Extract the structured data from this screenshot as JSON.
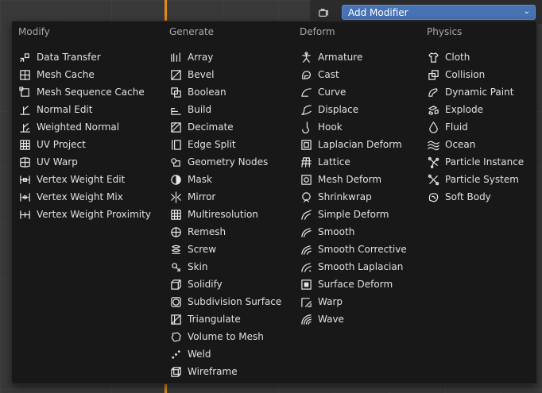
{
  "header": {
    "add_modifier_label": "Add Modifier"
  },
  "menu": {
    "columns": [
      {
        "title": "Modify",
        "items": [
          {
            "label": "Data Transfer",
            "icon": "data-transfer-icon"
          },
          {
            "label": "Mesh Cache",
            "icon": "mesh-cache-icon"
          },
          {
            "label": "Mesh Sequence Cache",
            "icon": "mesh-sequence-cache-icon"
          },
          {
            "label": "Normal Edit",
            "icon": "normal-edit-icon"
          },
          {
            "label": "Weighted Normal",
            "icon": "weighted-normal-icon"
          },
          {
            "label": "UV Project",
            "icon": "uv-project-icon"
          },
          {
            "label": "UV Warp",
            "icon": "uv-warp-icon"
          },
          {
            "label": "Vertex Weight Edit",
            "icon": "vertex-weight-edit-icon"
          },
          {
            "label": "Vertex Weight Mix",
            "icon": "vertex-weight-mix-icon"
          },
          {
            "label": "Vertex Weight Proximity",
            "icon": "vertex-weight-proximity-icon"
          }
        ]
      },
      {
        "title": "Generate",
        "items": [
          {
            "label": "Array",
            "icon": "array-icon"
          },
          {
            "label": "Bevel",
            "icon": "bevel-icon"
          },
          {
            "label": "Boolean",
            "icon": "boolean-icon"
          },
          {
            "label": "Build",
            "icon": "build-icon"
          },
          {
            "label": "Decimate",
            "icon": "decimate-icon"
          },
          {
            "label": "Edge Split",
            "icon": "edge-split-icon"
          },
          {
            "label": "Geometry Nodes",
            "icon": "geometry-nodes-icon"
          },
          {
            "label": "Mask",
            "icon": "mask-icon"
          },
          {
            "label": "Mirror",
            "icon": "mirror-icon"
          },
          {
            "label": "Multiresolution",
            "icon": "multiresolution-icon"
          },
          {
            "label": "Remesh",
            "icon": "remesh-icon"
          },
          {
            "label": "Screw",
            "icon": "screw-icon"
          },
          {
            "label": "Skin",
            "icon": "skin-icon"
          },
          {
            "label": "Solidify",
            "icon": "solidify-icon"
          },
          {
            "label": "Subdivision Surface",
            "icon": "subdivision-surface-icon"
          },
          {
            "label": "Triangulate",
            "icon": "triangulate-icon"
          },
          {
            "label": "Volume to Mesh",
            "icon": "volume-to-mesh-icon"
          },
          {
            "label": "Weld",
            "icon": "weld-icon"
          },
          {
            "label": "Wireframe",
            "icon": "wireframe-icon"
          }
        ]
      },
      {
        "title": "Deform",
        "items": [
          {
            "label": "Armature",
            "icon": "armature-icon"
          },
          {
            "label": "Cast",
            "icon": "cast-icon"
          },
          {
            "label": "Curve",
            "icon": "curve-icon"
          },
          {
            "label": "Displace",
            "icon": "displace-icon"
          },
          {
            "label": "Hook",
            "icon": "hook-icon"
          },
          {
            "label": "Laplacian Deform",
            "icon": "laplacian-deform-icon"
          },
          {
            "label": "Lattice",
            "icon": "lattice-icon"
          },
          {
            "label": "Mesh Deform",
            "icon": "mesh-deform-icon"
          },
          {
            "label": "Shrinkwrap",
            "icon": "shrinkwrap-icon"
          },
          {
            "label": "Simple Deform",
            "icon": "simple-deform-icon"
          },
          {
            "label": "Smooth",
            "icon": "smooth-icon"
          },
          {
            "label": "Smooth Corrective",
            "icon": "smooth-corrective-icon"
          },
          {
            "label": "Smooth Laplacian",
            "icon": "smooth-laplacian-icon"
          },
          {
            "label": "Surface Deform",
            "icon": "surface-deform-icon"
          },
          {
            "label": "Warp",
            "icon": "warp-icon"
          },
          {
            "label": "Wave",
            "icon": "wave-icon"
          }
        ]
      },
      {
        "title": "Physics",
        "items": [
          {
            "label": "Cloth",
            "icon": "cloth-icon"
          },
          {
            "label": "Collision",
            "icon": "collision-icon"
          },
          {
            "label": "Dynamic Paint",
            "icon": "dynamic-paint-icon"
          },
          {
            "label": "Explode",
            "icon": "explode-icon"
          },
          {
            "label": "Fluid",
            "icon": "fluid-icon"
          },
          {
            "label": "Ocean",
            "icon": "ocean-icon"
          },
          {
            "label": "Particle Instance",
            "icon": "particle-instance-icon"
          },
          {
            "label": "Particle System",
            "icon": "particle-system-icon"
          },
          {
            "label": "Soft Body",
            "icon": "soft-body-icon"
          }
        ]
      }
    ]
  },
  "colors": {
    "accent": "#4772b3",
    "menu_bg": "#181818",
    "text": "#e0e0e0",
    "header_text": "#a8a8a8",
    "viewport_edge": "#e08a1a"
  }
}
